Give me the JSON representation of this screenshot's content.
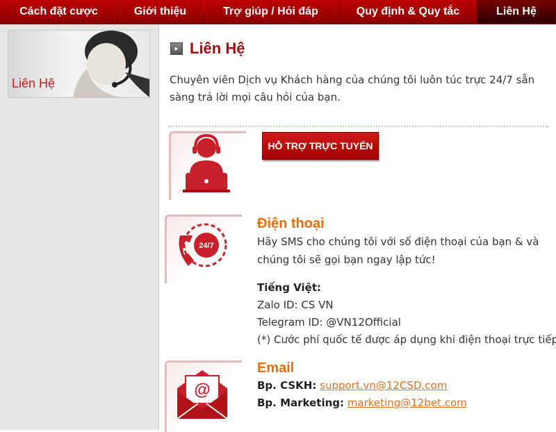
{
  "nav": {
    "items": [
      "Cách đặt cược",
      "Giới thiệu",
      "Trợ giúp / Hỏi đáp",
      "Quy định & Quy tắc",
      "Liên Hệ"
    ],
    "active_index": 4
  },
  "sidebar": {
    "banner_label": "Liên Hệ"
  },
  "main": {
    "title": "Liên Hệ",
    "intro": "Chuyên viên Dịch vụ Khách hàng của chúng tôi luôn túc trực 24/7 sẵn sàng trả lời mọi câu hỏi của bạn.",
    "support_button": "HỖ TRỢ TRỰC TUYẾN",
    "phone": {
      "title": "Điện thoại",
      "desc": "Hãy SMS cho chúng tôi với số điện thoại của bạn & và chúng tôi sẽ gọi bạn ngay lập tức!",
      "icon_text": "24/7",
      "lang_heading": "Tiếng Việt:",
      "zalo": "Zalo ID: CS VN",
      "telegram": "Telegram ID: @VN12Official",
      "note": "(*) Cước phí quốc tế được áp dụng khi điện thoại trực tiếp"
    },
    "email": {
      "title": "Email",
      "cskh_label": "Bp. CSKH:",
      "cskh_email": "support.vn@12CSD.com",
      "marketing_label": "Bp. Marketing:",
      "marketing_email": "marketing@12bet.com"
    }
  },
  "colors": {
    "nav_red": "#b00000",
    "title_red": "#a01010",
    "accent_orange": "#f06b00",
    "link_orange": "#e07020"
  }
}
